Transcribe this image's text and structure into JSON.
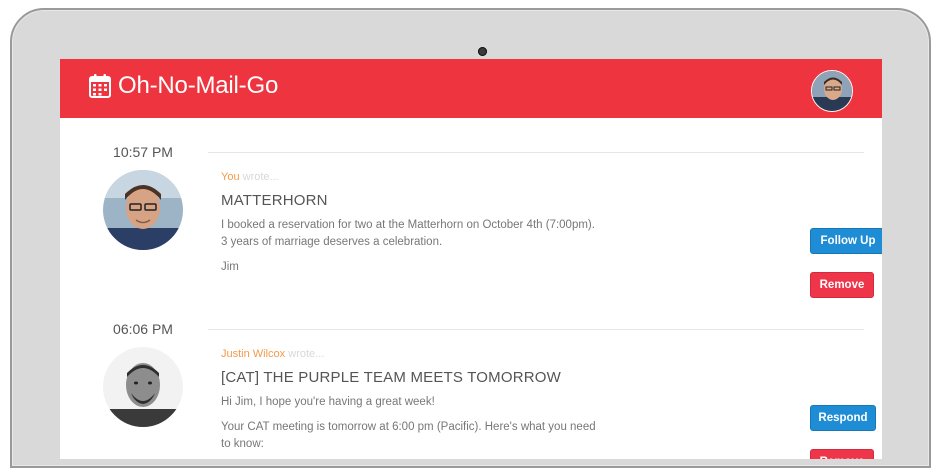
{
  "app": {
    "title": "Oh-No-Mail-Go",
    "brand_color": "#ee353f",
    "logo_icon": "calendar-icon",
    "user_avatar_icon": "user-avatar"
  },
  "messages": [
    {
      "time": "10:57 PM",
      "author": "You",
      "wrote": " wrote...",
      "subject": "MATTERHORN",
      "body": [
        "I booked a reservation for two at the Matterhorn on October 4th (7:00pm). 3 years of marriage deserves a celebration.",
        "Jim"
      ],
      "primary_action": "Follow Up",
      "secondary_action": "Remove"
    },
    {
      "time": "06:06 PM",
      "author": "Justin Wilcox",
      "wrote": " wrote...",
      "subject": "[CAT] THE PURPLE TEAM MEETS TOMORROW",
      "body": [
        "Hi Jim, I hope you're having a great week!",
        "Your CAT meeting is tomorrow at 6:00 pm (Pacific). Here's what you need to know:"
      ],
      "primary_action": "Respond",
      "secondary_action": "Remove"
    }
  ],
  "colors": {
    "accent_blue": "#1f8dd6",
    "remove_red": "#ee354a",
    "author_orange": "#f39a4a"
  }
}
